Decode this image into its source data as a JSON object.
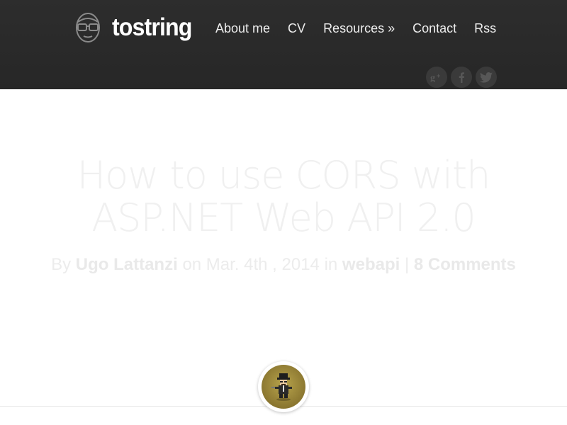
{
  "header": {
    "logo_text": "tostring",
    "logo_icon": "glasses-face-icon",
    "nav": [
      {
        "label": "About me"
      },
      {
        "label": "CV"
      },
      {
        "label": "Resources »"
      },
      {
        "label": "Contact"
      },
      {
        "label": "Rss"
      }
    ],
    "social": [
      {
        "icon": "google-plus-icon"
      },
      {
        "icon": "facebook-icon"
      },
      {
        "icon": "twitter-icon"
      }
    ],
    "background_color": "#2b2b2b"
  },
  "post": {
    "title_line1": "How to use CORS with",
    "title_line2": "ASP.NET Web API 2.0",
    "meta": {
      "by": "By",
      "author": "Ugo Lattanzi",
      "on": "on Mar. 4th , 2014 in",
      "category": "webapi",
      "separator": "|",
      "comments": "8 Comments"
    }
  },
  "author_avatar": {
    "icon": "pixel-character-avatar",
    "background_color": "#9c8a3a"
  }
}
